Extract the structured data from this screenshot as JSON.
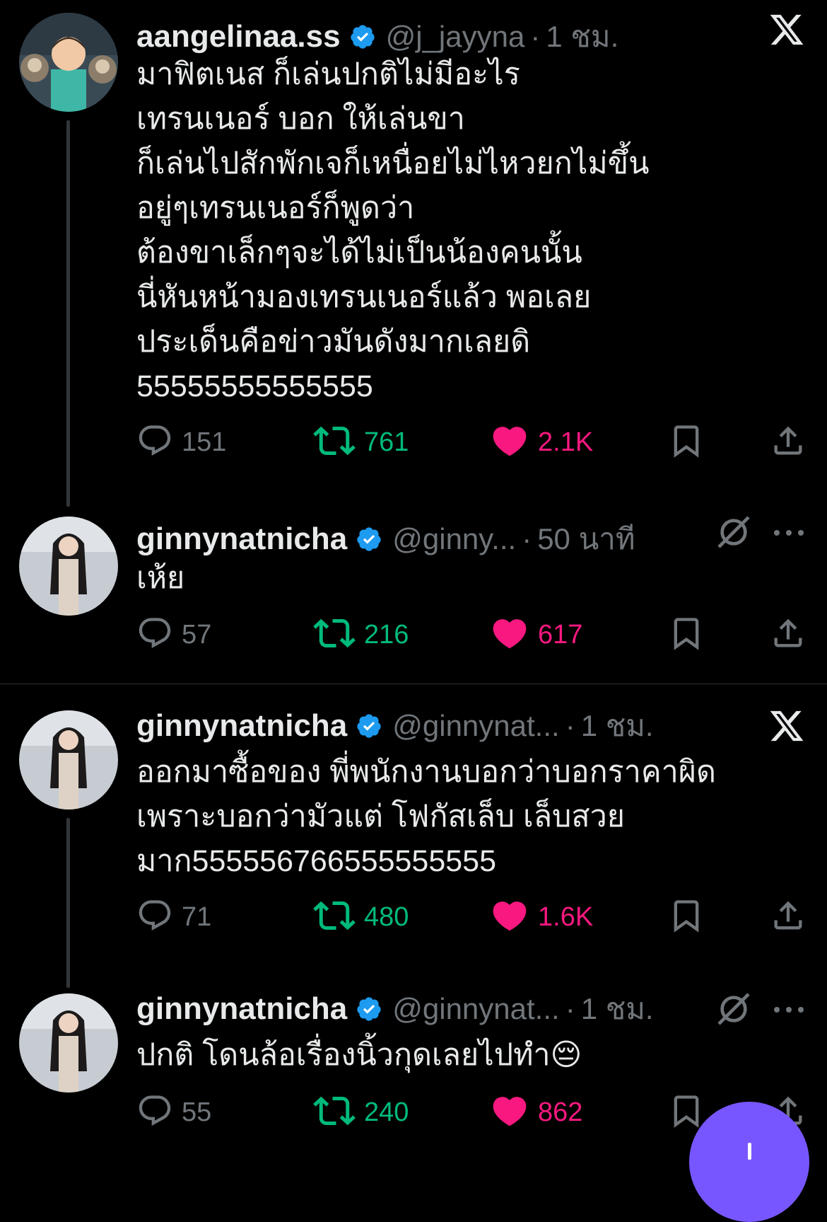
{
  "tweets": [
    {
      "name": "aangelinaa.ss",
      "handle": "@j_jayyna",
      "dot": "·",
      "time": "1 ชม.",
      "text": "มาฟิตเนส ก็เล่นปกติไม่มีอะไร\nเทรนเนอร์ บอก ให้เล่นขา\nก็เล่นไปสักพักเจก็เหนื่อยไม่ไหวยกไม่ขึ้น\nอยู่ๆเทรนเนอร์ก็พูดว่า\nต้องขาเล็กๆจะได้ไม่เป็นน้องคนนั้น\nนี่หันหน้ามองเทรนเนอร์แล้ว พอเลย\nประเด็นคือข่าวมันดังมากเลยดิ\n55555555555555",
      "replies": "151",
      "retweets": "761",
      "likes": "2.1K",
      "corner_icon": "x-logo-icon"
    },
    {
      "name": "ginnynatnicha",
      "handle": "@ginny...",
      "dot": "·",
      "time": "50 นาที",
      "text": "เห้ย",
      "replies": "57",
      "retweets": "216",
      "likes": "617",
      "corner_icon": "grok-icon"
    },
    {
      "name": "ginnynatnicha",
      "handle": "@ginnynat...",
      "dot": "·",
      "time": "1 ชม.",
      "text": "ออกมาซื้อของ พี่พนักงานบอกว่าบอกราคาผิด\nเพราะบอกว่ามัวแต่ โฟกัสเล็บ เล็บสวย\nมาก555556766555555555",
      "replies": "71",
      "retweets": "480",
      "likes": "1.6K",
      "corner_icon": "x-logo-icon"
    },
    {
      "name": "ginnynatnicha",
      "handle": "@ginnynat...",
      "dot": "·",
      "time": "1 ชม.",
      "text": "ปกติ โดนล้อเรื่องนิ้วกุดเลยไปทำ😔",
      "replies": "55",
      "retweets": "240",
      "likes": "862",
      "corner_icon": "grok-icon"
    }
  ],
  "colors": {
    "background": "#000000",
    "text": "#e7e9ea",
    "secondary": "#71767b",
    "retweet": "#00ba7c",
    "like": "#f91880",
    "verified": "#1d9bf0",
    "fab": "#7856ff"
  }
}
